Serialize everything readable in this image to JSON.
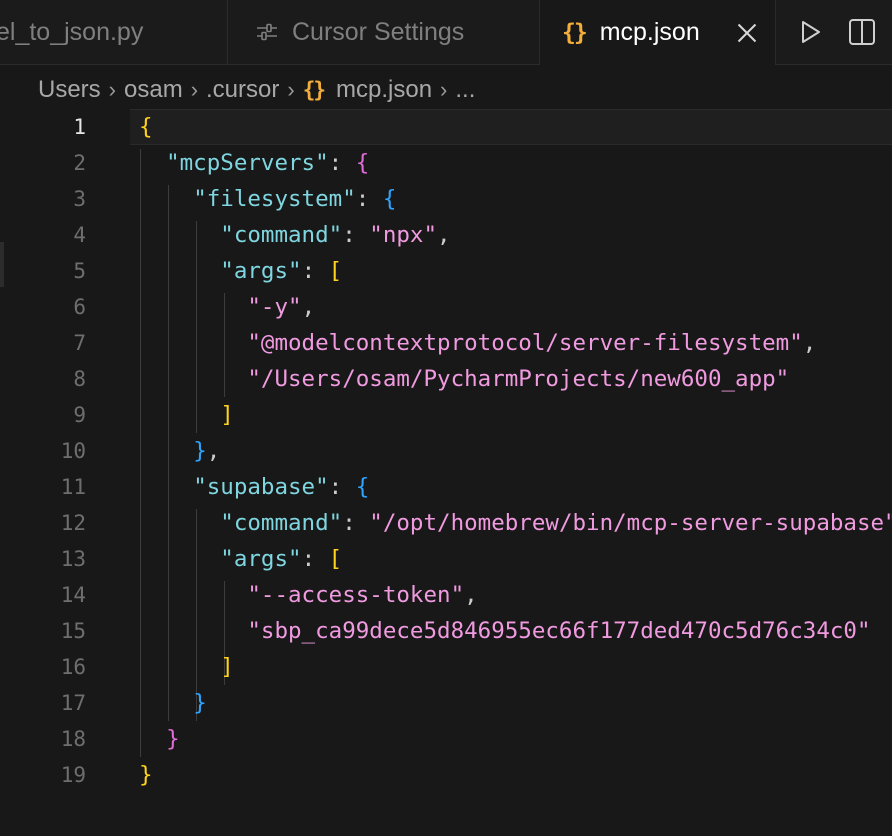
{
  "tabs": [
    {
      "label": "el_to_json.py"
    },
    {
      "label": "Cursor Settings",
      "icon": "sliders-icon"
    },
    {
      "label": "mcp.json",
      "icon": "braces-icon",
      "active": true
    }
  ],
  "breadcrumb": {
    "items": [
      "Users",
      "osam",
      ".cursor",
      "mcp.json",
      "..."
    ],
    "file_icon": "{}"
  },
  "editor": {
    "active_line": 1,
    "lines": [
      {
        "n": "1"
      },
      {
        "n": "2"
      },
      {
        "n": "3"
      },
      {
        "n": "4"
      },
      {
        "n": "5"
      },
      {
        "n": "6"
      },
      {
        "n": "7"
      },
      {
        "n": "8"
      },
      {
        "n": "9"
      },
      {
        "n": "10"
      },
      {
        "n": "11"
      },
      {
        "n": "12"
      },
      {
        "n": "13"
      },
      {
        "n": "14"
      },
      {
        "n": "15"
      },
      {
        "n": "16"
      },
      {
        "n": "17"
      },
      {
        "n": "18"
      },
      {
        "n": "19"
      }
    ],
    "tokens": {
      "open_root": "{",
      "k_mcpServers": "\"mcpServers\"",
      "k_filesystem": "\"filesystem\"",
      "k_command": "\"command\"",
      "v_npx": "\"npx\"",
      "k_args": "\"args\"",
      "v_y": "\"-y\"",
      "v_server_fs": "\"@modelcontextprotocol/server-filesystem\"",
      "v_path": "\"/Users/osam/PycharmProjects/new600_app\"",
      "k_supabase": "\"supabase\"",
      "v_supabase_cmd": "\"/opt/homebrew/bin/mcp-server-supabase\"",
      "v_access_token": "\"--access-token\"",
      "v_token": "\"sbp_ca99dece5d846955ec66f177ded470c5d76c34c0\"",
      "colon": ": ",
      "comma": ",",
      "lbrace": "{",
      "rbrace": "}",
      "lbracket": "[",
      "rbracket": "]"
    }
  },
  "colors": {
    "background": "#181818",
    "json_icon": "#f2ad3b",
    "key": "#7fd6e0",
    "string": "#f09ae0",
    "bracket_level1": "#ffd31a",
    "bracket_level2": "#e06cd8",
    "bracket_level3": "#2fa4ff"
  }
}
